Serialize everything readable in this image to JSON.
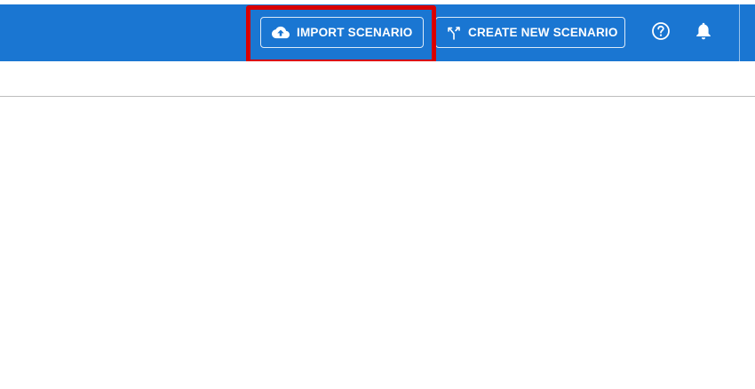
{
  "colors": {
    "topbar": "#1a76d2",
    "highlight": "#d90000",
    "button_text": "#ffffff"
  },
  "toolbar": {
    "import_label": "IMPORT SCENARIO",
    "import_icon": "cloud-upload-icon",
    "create_label": "CREATE NEW SCENARIO",
    "create_icon": "merge-arrows-icon",
    "help_icon": "help-circle-icon",
    "notifications_icon": "bell-icon"
  }
}
